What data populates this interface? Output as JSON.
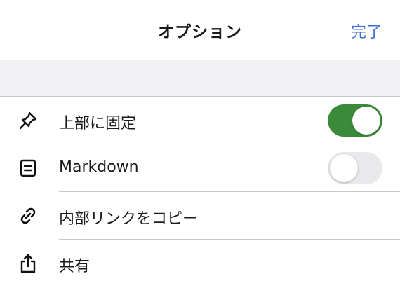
{
  "nav": {
    "title": "オプション",
    "done_label": "完了"
  },
  "options": [
    {
      "label": "上部に固定",
      "icon": "pin-icon",
      "toggle": true,
      "on": true
    },
    {
      "label": "Markdown",
      "icon": "document-icon",
      "toggle": true,
      "on": false
    },
    {
      "label": "内部リンクをコピー",
      "icon": "link-icon",
      "toggle": false
    },
    {
      "label": "共有",
      "icon": "share-icon",
      "toggle": false
    }
  ],
  "colors": {
    "accent": "#3d6fd6",
    "toggle_on": "#3b8a3a",
    "toggle_off": "#e9e9eb",
    "group_background": "#f2f2f5",
    "separator": "#c8c8cc"
  }
}
